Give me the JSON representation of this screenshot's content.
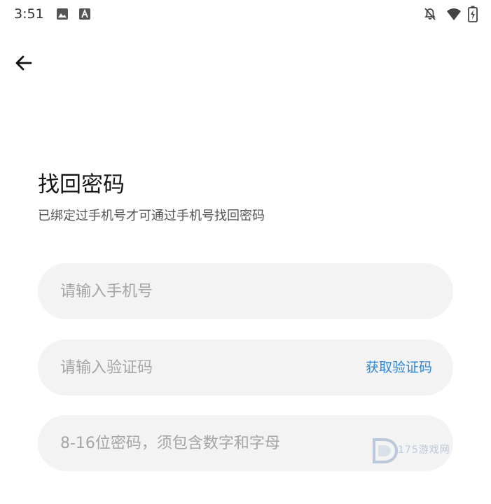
{
  "status_bar": {
    "time": "3:51",
    "icons": [
      "gallery-icon",
      "app-notification-icon",
      "bell-off-icon",
      "wifi-icon",
      "battery-icon"
    ]
  },
  "header": {
    "back_icon": "arrow-left-icon"
  },
  "page": {
    "title": "找回密码",
    "subtitle": "已绑定过手机号才可通过手机号找回密码"
  },
  "form": {
    "phone": {
      "placeholder": "请输入手机号",
      "value": ""
    },
    "code": {
      "placeholder": "请输入验证码",
      "value": "",
      "get_code_label": "获取验证码"
    },
    "password": {
      "placeholder": "8-16位密码，须包含数字和字母",
      "value": ""
    }
  },
  "watermark": {
    "text": "175游戏网"
  },
  "colors": {
    "accent": "#2f86d6",
    "field_bg": "#f3f3f3",
    "placeholder": "#a5a5a5",
    "title": "#151515",
    "subtitle": "#555555"
  }
}
